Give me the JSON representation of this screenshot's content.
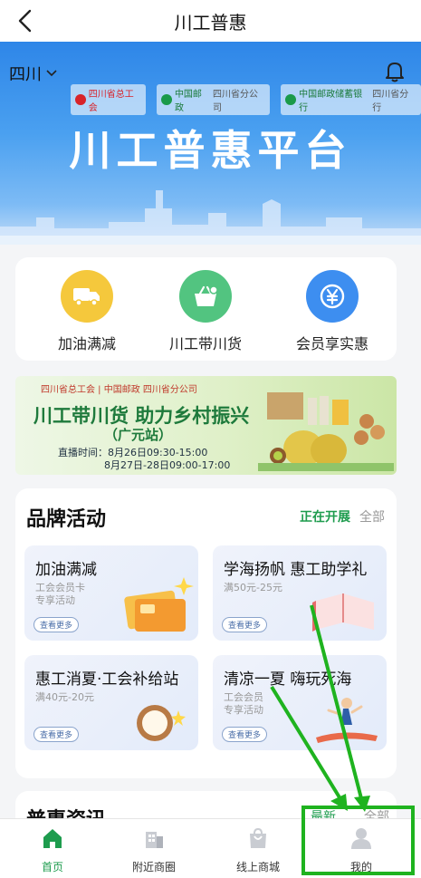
{
  "header": {
    "title": "川工普惠"
  },
  "hero": {
    "region": "四川",
    "logo1": "四川省总工会",
    "logo2": "中国邮政",
    "logo2_sub": "四川省分公司",
    "logo3": "中国邮政储蓄银行",
    "logo3_sub": "四川省分行",
    "title": "川工普惠平台"
  },
  "quick_actions": [
    {
      "label": "加油满减",
      "icon": "truck-icon",
      "color": "#f5c83c"
    },
    {
      "label": "川工带川货",
      "icon": "basket-icon",
      "color": "#52c480"
    },
    {
      "label": "会员享实惠",
      "icon": "yen-icon",
      "color": "#3d8ef0"
    }
  ],
  "banner": {
    "logos": "四川省总工会 | 中国邮政 四川省分公司",
    "title": "川工带川货 助力乡村振兴",
    "subtitle": "（广元站）",
    "time1": "直播时间：8月26日09:30-15:00",
    "time2": "8月27日-28日09:00-17:00"
  },
  "brand": {
    "title": "品牌活动",
    "tab_active": "正在开展",
    "tab_all": "全部",
    "more_label": "查看更多",
    "items": [
      {
        "title": "加油满减",
        "sub1": "工会会员卡",
        "sub2": "专享活动"
      },
      {
        "title": "学海扬帆 惠工助学礼",
        "sub1": "满50元-25元",
        "sub2": ""
      },
      {
        "title": "惠工消夏·工会补给站",
        "sub1": "满40元-20元",
        "sub2": ""
      },
      {
        "title": "清凉一夏 嗨玩死海",
        "sub1": "工会会员",
        "sub2": "专享活动"
      }
    ]
  },
  "news": {
    "title": "普惠资讯",
    "tab_latest": "最新",
    "tab_all": "全部"
  },
  "tabbar": [
    {
      "label": "首页",
      "icon": "home-icon",
      "active": true
    },
    {
      "label": "附近商圈",
      "icon": "building-icon",
      "active": false
    },
    {
      "label": "线上商城",
      "icon": "shopping-bag-icon",
      "active": false
    },
    {
      "label": "我的",
      "icon": "user-icon",
      "active": false
    }
  ],
  "colors": {
    "accent": "#1e9c4e",
    "highlight": "#1fb31f"
  }
}
